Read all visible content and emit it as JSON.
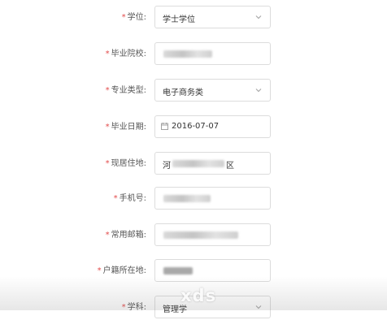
{
  "form": {
    "degree": {
      "label": "学位:",
      "value": "学士学位"
    },
    "school": {
      "label": "毕业院校:"
    },
    "major_type": {
      "label": "专业类型:",
      "value": "电子商务类"
    },
    "grad_date": {
      "label": "毕业日期:",
      "value": "2016-07-07"
    },
    "address": {
      "label": "现居住地:",
      "value_start": "河",
      "value_end": "区"
    },
    "phone": {
      "label": "手机号:"
    },
    "email": {
      "label": "常用邮箱:"
    },
    "hukou": {
      "label": "户籍所在地:"
    },
    "subject": {
      "label": "学科:",
      "value": "管理学"
    }
  },
  "watermark": "xds",
  "icons": {
    "select": "chevron-down-icon",
    "date": "calendar-icon"
  },
  "colors": {
    "required": "#e34b4b",
    "border": "#dcdcdc"
  }
}
